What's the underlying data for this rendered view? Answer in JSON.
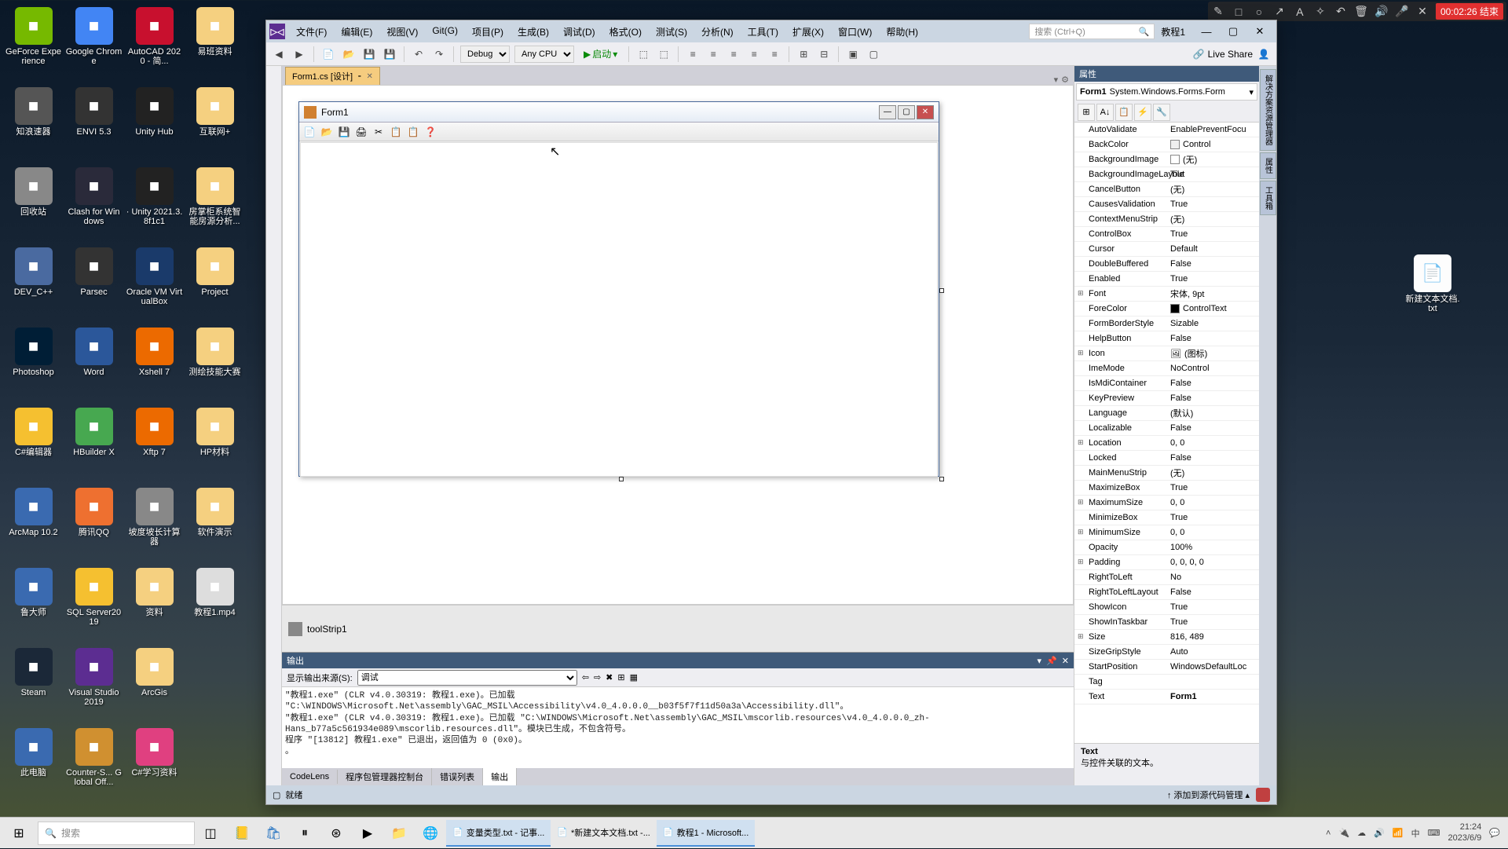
{
  "recording": {
    "timer": "00:02:26 结束"
  },
  "desktop": {
    "icons": [
      [
        "GeForce Experience",
        "#76b900"
      ],
      [
        "Google Chrome",
        "#4285f4"
      ],
      [
        "AutoCAD 2020 - 简...",
        "#c8102e"
      ],
      [
        "易班资料",
        "#f5d080"
      ],
      [
        "知浪速器",
        "#555"
      ],
      [
        "ENVI 5.3",
        "#333"
      ],
      [
        "Unity Hub",
        "#222"
      ],
      [
        "互联网+",
        "#f5d080"
      ],
      [
        "回收站",
        "#888"
      ],
      [
        "Clash for Windows",
        "#2a2a3a"
      ],
      [
        "· Unity 2021.3.8f1c1",
        "#222"
      ],
      [
        "房掌柜系统智能房源分析...",
        "#f5d080"
      ],
      [
        "DEV_C++",
        "#4a6aa0"
      ],
      [
        "Parsec",
        "#333"
      ],
      [
        "Oracle VM VirtualBox",
        "#1a3a6a"
      ],
      [
        "Project",
        "#f5d080"
      ],
      [
        "Photoshop",
        "#001e36"
      ],
      [
        "Word",
        "#2b579a"
      ],
      [
        "Xshell 7",
        "#ec6a00"
      ],
      [
        "测绘技能大赛",
        "#f5d080"
      ],
      [
        "C#编辑器",
        "#f5c030"
      ],
      [
        "HBuilder X",
        "#47a850"
      ],
      [
        "Xftp 7",
        "#ec6a00"
      ],
      [
        "HP材料",
        "#f5d080"
      ],
      [
        "ArcMap 10.2",
        "#3a6ab0"
      ],
      [
        "腾讯QQ",
        "#ee7030"
      ],
      [
        "坡度坡长计算器",
        "#888"
      ],
      [
        "软件演示",
        "#f5d080"
      ],
      [
        "鲁大师",
        "#3a6ab0"
      ],
      [
        "SQL Server2019",
        "#f5c030"
      ],
      [
        "资料",
        "#f5d080"
      ],
      [
        "教程1.mp4",
        "#ddd"
      ],
      [
        "Steam",
        "#1b2838"
      ],
      [
        "Visual Studio 2019",
        "#5c2d91"
      ],
      [
        "ArcGis",
        "#f5d080"
      ],
      [
        "",
        ""
      ],
      [
        "此电脑",
        "#3a6ab0"
      ],
      [
        "Counter-S... Global Off...",
        "#d09030"
      ],
      [
        "C#学习资料",
        "#e04080"
      ],
      [
        "",
        ""
      ]
    ],
    "rightIcon": {
      "label": "新建文本文档.txt"
    }
  },
  "vs": {
    "menu": [
      "文件(F)",
      "编辑(E)",
      "视图(V)",
      "Git(G)",
      "项目(P)",
      "生成(B)",
      "调试(D)",
      "格式(O)",
      "测试(S)",
      "分析(N)",
      "工具(T)",
      "扩展(X)",
      "窗口(W)",
      "帮助(H)"
    ],
    "searchPlaceholder": "搜索 (Ctrl+Q)",
    "solutionName": "教程1",
    "toolbar": {
      "config": "Debug",
      "platform": "Any CPU",
      "start": "启动",
      "liveshare": "Live Share"
    },
    "tab": {
      "name": "Form1.cs [设计]"
    },
    "form": {
      "title": "Form1",
      "toolstrip": [
        "📄",
        "📂",
        "💾",
        "🖨",
        "✂",
        "📋",
        "📋",
        "❓"
      ]
    },
    "componentTray": "toolStrip1",
    "output": {
      "title": "输出",
      "sourceLabel": "显示输出来源(S):",
      "sourceValue": "调试",
      "text": "\"教程1.exe\" (CLR v4.0.30319: 教程1.exe)。已加载 \"C:\\WINDOWS\\Microsoft.Net\\assembly\\GAC_MSIL\\Accessibility\\v4.0_4.0.0.0__b03f5f7f11d50a3a\\Accessibility.dll\"。\n\"教程1.exe\" (CLR v4.0.30319: 教程1.exe)。已加载 \"C:\\WINDOWS\\Microsoft.Net\\assembly\\GAC_MSIL\\mscorlib.resources\\v4.0_4.0.0.0_zh-Hans_b77a5c561934e089\\mscorlib.resources.dll\"。模块已生成，不包含符号。\n程序 \"[13812] 教程1.exe\" 已退出，返回值为 0 (0x0)。\n。",
      "tabs": [
        "CodeLens",
        "程序包管理器控制台",
        "错误列表",
        "输出"
      ]
    },
    "props": {
      "title": "属性",
      "object": {
        "name": "Form1",
        "type": "System.Windows.Forms.Form"
      },
      "rows": [
        [
          "AutoValidate",
          "EnablePreventFocu",
          false,
          null
        ],
        [
          "BackColor",
          "Control",
          false,
          "#f0f0f0"
        ],
        [
          "BackgroundImage",
          "(无)",
          false,
          "#fff"
        ],
        [
          "BackgroundImageLayout",
          "Tile",
          false,
          null
        ],
        [
          "CancelButton",
          "(无)",
          false,
          null
        ],
        [
          "CausesValidation",
          "True",
          false,
          null
        ],
        [
          "ContextMenuStrip",
          "(无)",
          false,
          null
        ],
        [
          "ControlBox",
          "True",
          false,
          null
        ],
        [
          "Cursor",
          "Default",
          false,
          null
        ],
        [
          "DoubleBuffered",
          "False",
          false,
          null
        ],
        [
          "Enabled",
          "True",
          false,
          null
        ],
        [
          "Font",
          "宋体, 9pt",
          true,
          null
        ],
        [
          "ForeColor",
          "ControlText",
          false,
          "#000"
        ],
        [
          "FormBorderStyle",
          "Sizable",
          false,
          null
        ],
        [
          "HelpButton",
          "False",
          false,
          null
        ],
        [
          "Icon",
          "(图标)",
          true,
          "icon"
        ],
        [
          "ImeMode",
          "NoControl",
          false,
          null
        ],
        [
          "IsMdiContainer",
          "False",
          false,
          null
        ],
        [
          "KeyPreview",
          "False",
          false,
          null
        ],
        [
          "Language",
          "(默认)",
          false,
          null
        ],
        [
          "Localizable",
          "False",
          false,
          null
        ],
        [
          "Location",
          "0, 0",
          true,
          null
        ],
        [
          "Locked",
          "False",
          false,
          null
        ],
        [
          "MainMenuStrip",
          "(无)",
          false,
          null
        ],
        [
          "MaximizeBox",
          "True",
          false,
          null
        ],
        [
          "MaximumSize",
          "0, 0",
          true,
          null
        ],
        [
          "MinimizeBox",
          "True",
          false,
          null
        ],
        [
          "MinimumSize",
          "0, 0",
          true,
          null
        ],
        [
          "Opacity",
          "100%",
          false,
          null
        ],
        [
          "Padding",
          "0, 0, 0, 0",
          true,
          null
        ],
        [
          "RightToLeft",
          "No",
          false,
          null
        ],
        [
          "RightToLeftLayout",
          "False",
          false,
          null
        ],
        [
          "ShowIcon",
          "True",
          false,
          null
        ],
        [
          "ShowInTaskbar",
          "True",
          false,
          null
        ],
        [
          "Size",
          "816, 489",
          true,
          null
        ],
        [
          "SizeGripStyle",
          "Auto",
          false,
          null
        ],
        [
          "StartPosition",
          "WindowsDefaultLoc",
          false,
          null
        ],
        [
          "Tag",
          "",
          false,
          null
        ],
        [
          "Text",
          "Form1",
          false,
          null
        ]
      ],
      "desc": {
        "name": "Text",
        "text": "与控件关联的文本。"
      }
    },
    "rightTabs": [
      "解决方案资源管理器",
      "属性",
      "工具箱"
    ],
    "status": {
      "ready": "就绪",
      "source": "添加到源代码管理"
    }
  },
  "taskbar": {
    "search": "搜索",
    "tasks": [
      {
        "label": "变量类型.txt - 记事...",
        "active": true
      },
      {
        "label": "*新建文本文档.txt -...",
        "active": false
      },
      {
        "label": "教程1 - Microsoft...",
        "active": true
      }
    ],
    "time": "21:24",
    "date": "2023/6/9"
  }
}
